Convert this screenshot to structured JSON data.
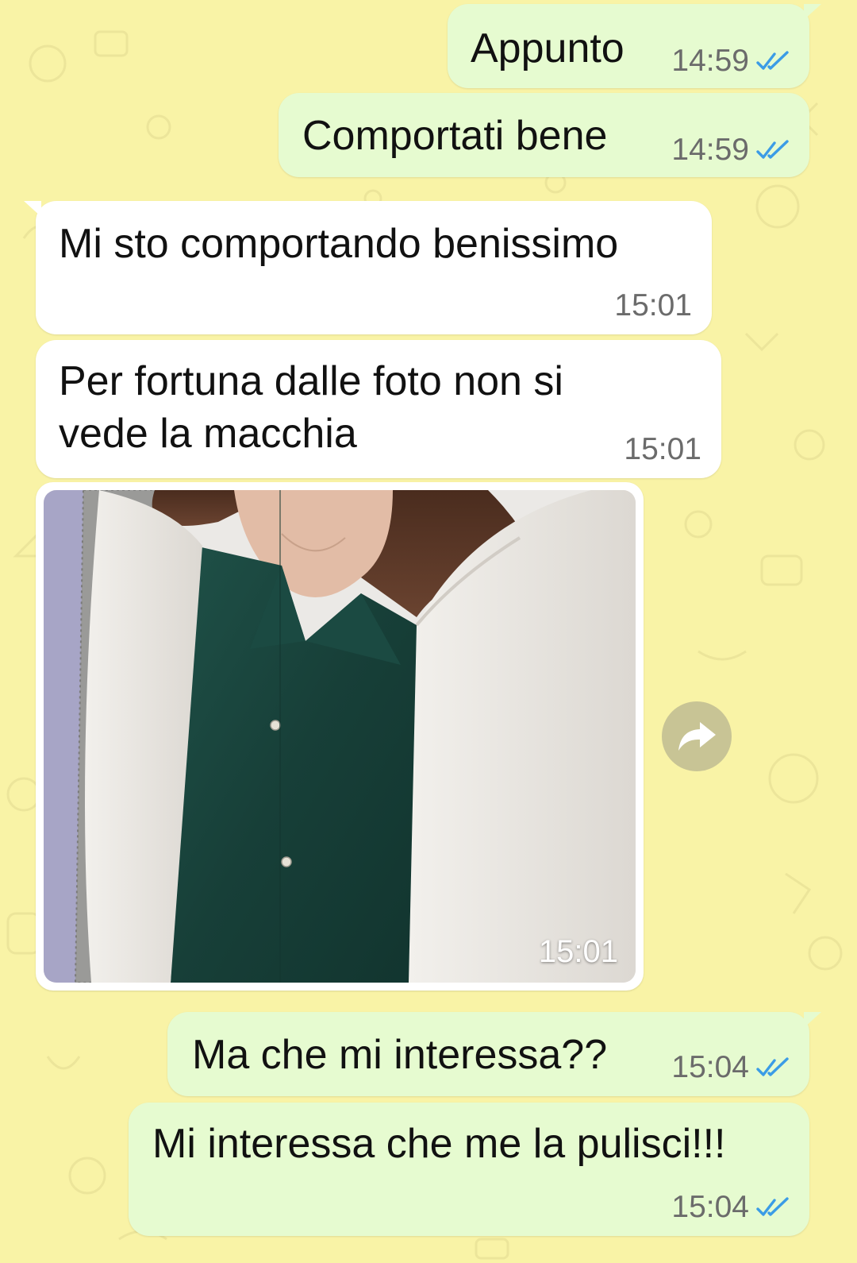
{
  "colors": {
    "wallpaper": "#f9f3a6",
    "outgoing_bubble": "#e6fbd0",
    "incoming_bubble": "#ffffff",
    "read_ticks": "#3b9ce6"
  },
  "messages": [
    {
      "direction": "outgoing",
      "text": "Appunto",
      "time": "14:59",
      "status": "read"
    },
    {
      "direction": "outgoing",
      "text": "Comportati bene",
      "time": "14:59",
      "status": "read"
    },
    {
      "direction": "incoming",
      "text": "Mi sto comportando benissimo",
      "time": "15:01"
    },
    {
      "direction": "incoming",
      "text_line1": "Per fortuna dalle foto non si",
      "text_line2": "vede la macchia",
      "time": "15:01"
    },
    {
      "direction": "incoming",
      "type": "photo",
      "time": "15:01"
    },
    {
      "direction": "outgoing",
      "text": "Ma che mi interessa??",
      "time": "15:04",
      "status": "read"
    },
    {
      "direction": "outgoing",
      "text": "Mi interessa che me la pulisci!!!",
      "time": "15:04",
      "status": "read"
    }
  ],
  "icons": {
    "read": "double-check-icon",
    "forward": "forward-arrow-icon"
  }
}
